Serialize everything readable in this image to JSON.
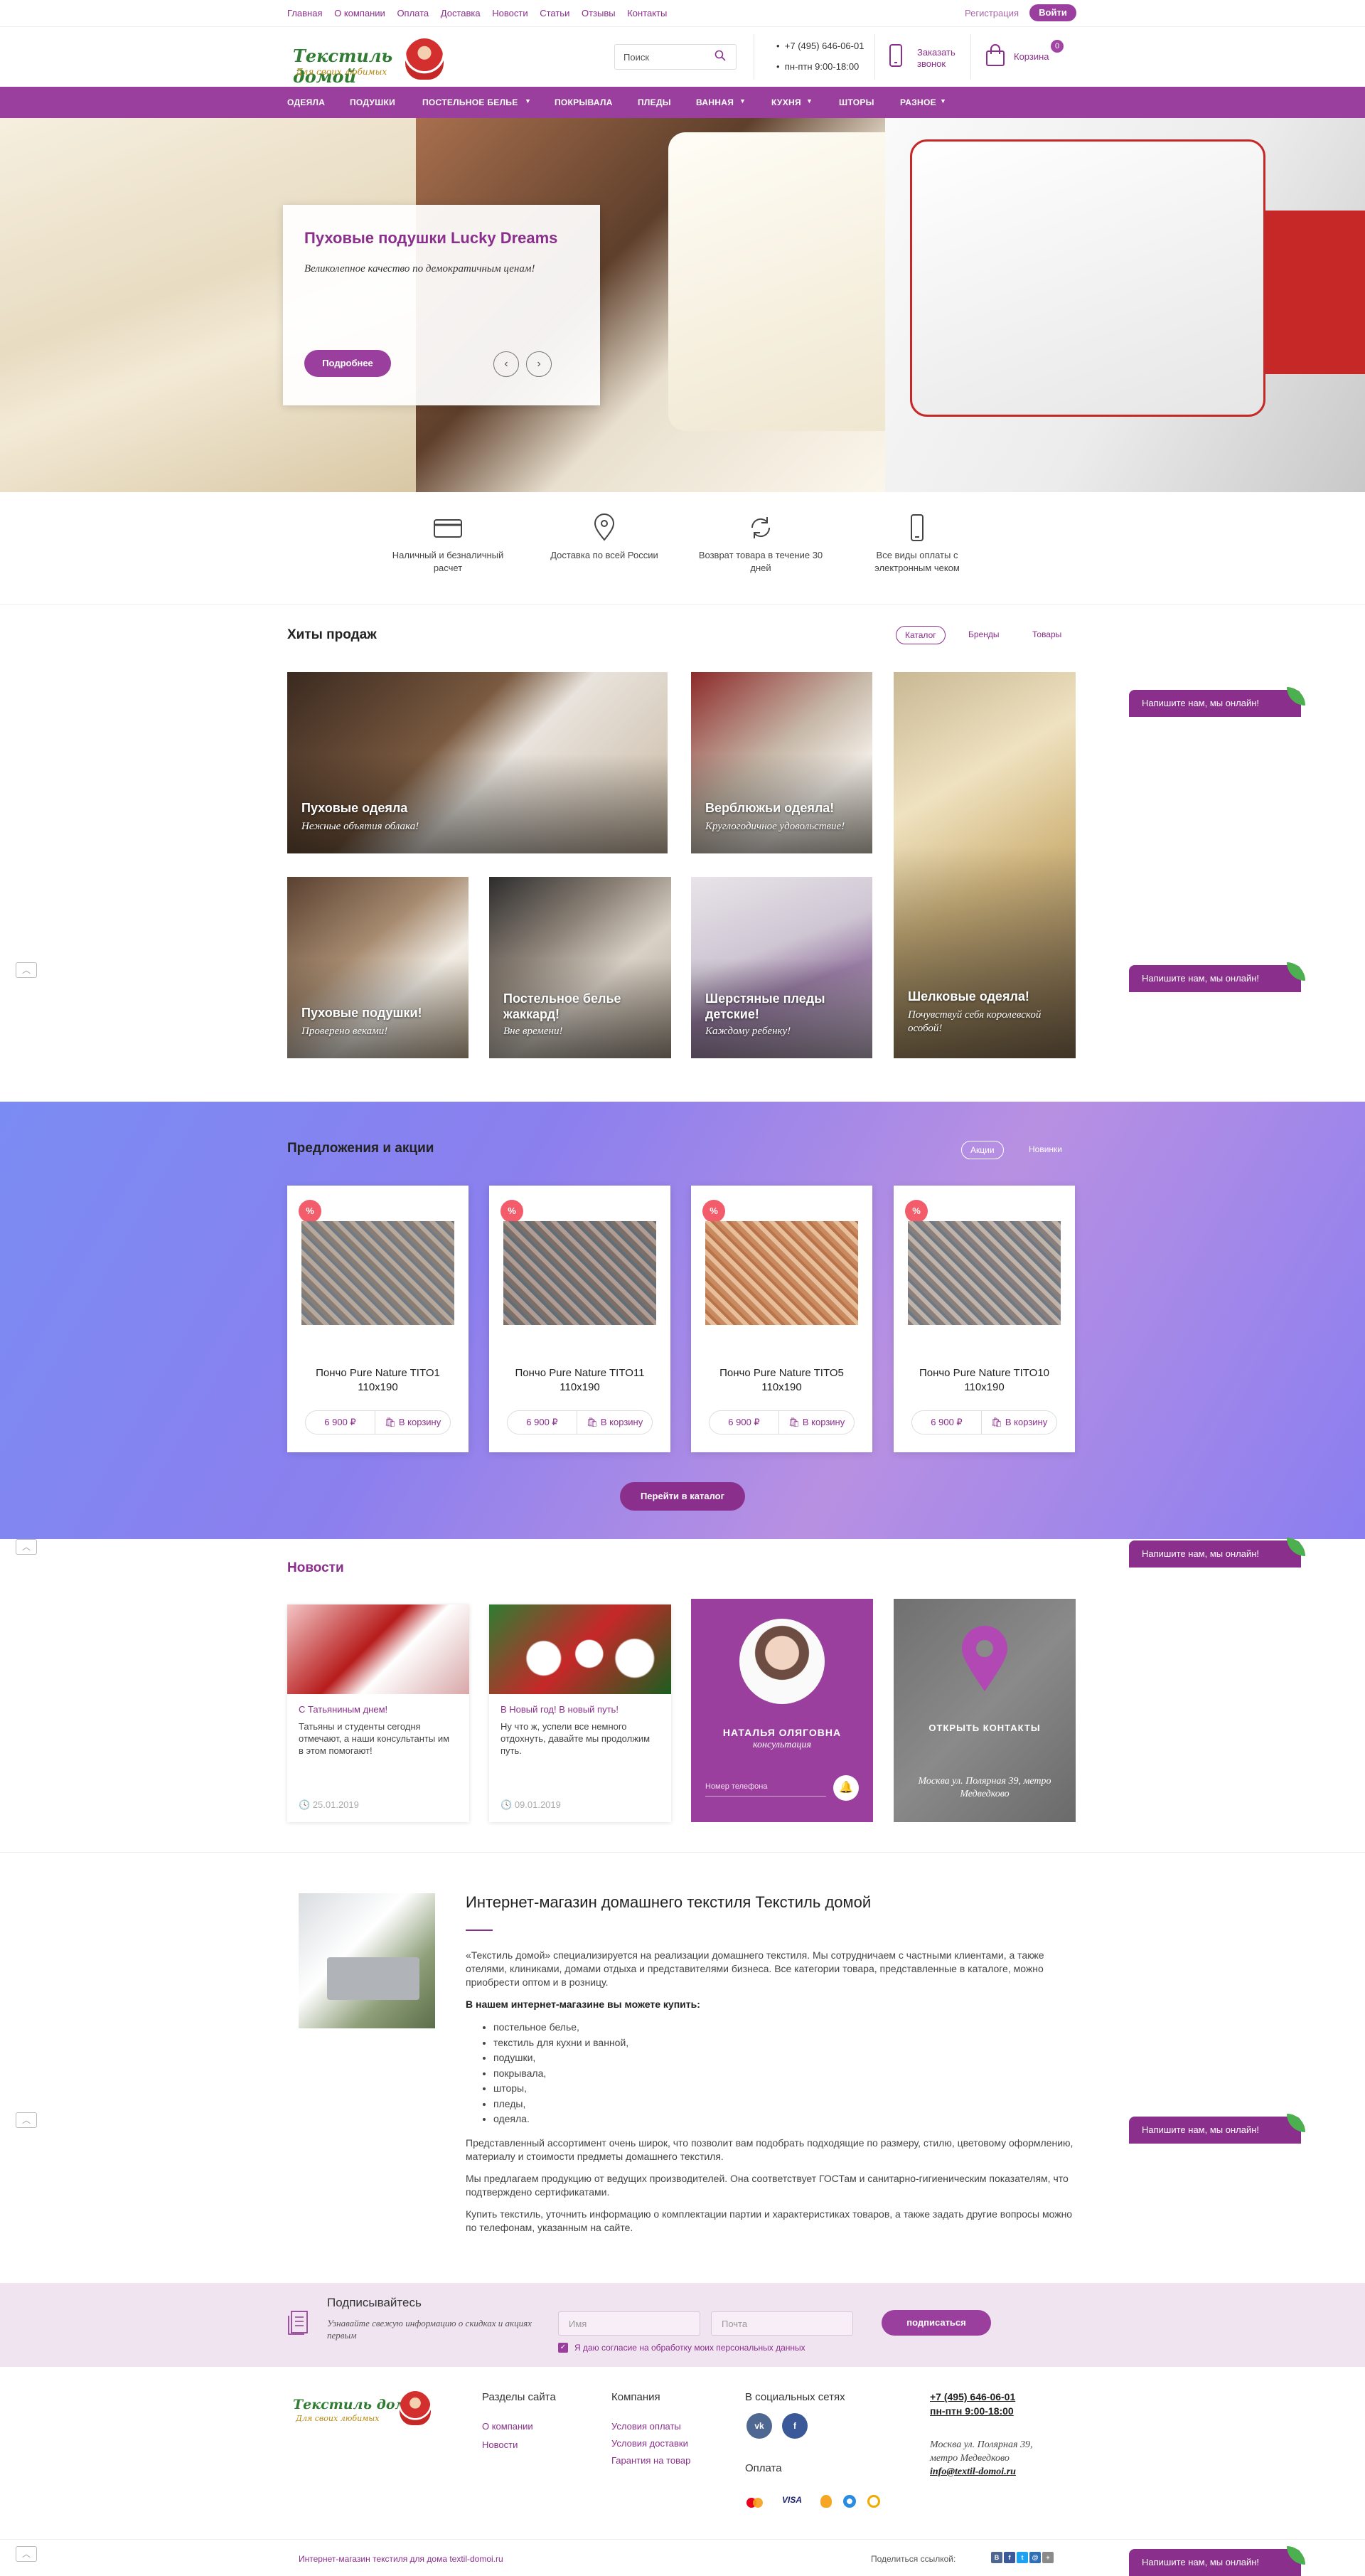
{
  "topnav": [
    "Главная",
    "О компании",
    "Оплата",
    "Доставка",
    "Новости",
    "Статьи",
    "Отзывы",
    "Контакты"
  ],
  "auth": {
    "register": "Регистрация",
    "login": "Войти"
  },
  "logo": {
    "name": "Текстиль домой",
    "tagline": "Для своих любимых"
  },
  "search": {
    "placeholder": "Поиск"
  },
  "contacts": {
    "phone": "+7 (495) 646-06-01",
    "hours": "пн-птн 9:00-18:00"
  },
  "callback": {
    "line1": "Заказать",
    "line2": "звонок"
  },
  "cart": {
    "label": "Корзина",
    "count": "0"
  },
  "mainnav": [
    "ОДЕЯЛА",
    "ПОДУШКИ",
    "ПОСТЕЛЬНОЕ БЕЛЬЕ",
    "ПОКРЫВАЛА",
    "ПЛЕДЫ",
    "ВАННАЯ",
    "КУХНЯ",
    "ШТОРЫ",
    "РАЗНОЕ"
  ],
  "hero": {
    "title": "Пуховые подушки Lucky Dreams",
    "subtitle": "Великолепное качество по демократичным ценам!",
    "button": "Подробнее",
    "prev": "‹",
    "next": "›"
  },
  "features": [
    {
      "icon": "card-icon",
      "text": "Наличный и безналичный расчет"
    },
    {
      "icon": "location-pin-icon",
      "text": "Доставка по всей России"
    },
    {
      "icon": "return-icon",
      "text": "Возврат товара в течение 30 дней"
    },
    {
      "icon": "phone-icon",
      "text": "Все виды оплаты с электронным чеком"
    }
  ],
  "hits": {
    "title": "Хиты продаж",
    "tabs": [
      "Каталог",
      "Бренды",
      "Товары"
    ],
    "tiles": [
      {
        "title": "Пуховые одеяла",
        "sub": "Нежные объятия облака!"
      },
      {
        "title": "Верблюжьи одеяла!",
        "sub": "Круглогодичное удовольствие!"
      },
      {
        "title": "Шелковые одеяла!",
        "sub": "Почувствуй себя королевской особой!"
      },
      {
        "title": "Пуховые подушки!",
        "sub": "Проверено веками!"
      },
      {
        "title": "Постельное белье жаккард!",
        "sub": "Вне времени!"
      },
      {
        "title": "Шерстяные пледы детские!",
        "sub": "Каждому ребенку!"
      }
    ]
  },
  "offers": {
    "title": "Предложения и акции",
    "tabs": [
      "Акции",
      "Новинки"
    ],
    "badge": "%",
    "products": [
      {
        "name": "Пончо Pure Nature TITO1 110х190",
        "price": "6 900 ₽",
        "cart": "В корзину"
      },
      {
        "name": "Пончо Pure Nature TITO11 110х190",
        "price": "6 900 ₽",
        "cart": "В корзину"
      },
      {
        "name": "Пончо Pure Nature TITO5 110х190",
        "price": "6 900 ₽",
        "cart": "В корзину"
      },
      {
        "name": "Пончо Pure Nature TITO10 110х190",
        "price": "6 900 ₽",
        "cart": "В корзину"
      }
    ],
    "catalog_button": "Перейти в каталог"
  },
  "news": {
    "title": "Новости",
    "items": [
      {
        "head": "С Татьяниным днем!",
        "text": "Татьяны и студенты сегодня отмечают, а наши консультанты им в этом помогают!",
        "date": "25.01.2019"
      },
      {
        "head": "В Новый год! В новый путь!",
        "text": "Ну что ж, успели все немного отдохнуть, давайте мы продолжим путь.",
        "date": "09.01.2019"
      }
    ],
    "consult": {
      "name": "НАТАЛЬЯ ОЛЯГОВНА",
      "role": "консультация",
      "placeholder": "Номер телефона"
    },
    "map": {
      "title": "ОТКРЫТЬ КОНТАКТЫ",
      "address": "Москва ул. Полярная 39, метро Медведково"
    }
  },
  "chat": "Напишите нам, мы онлайн!",
  "about": {
    "title": "Интернет-магазин домашнего текстиля Текстиль домой",
    "p1": "«Текстиль домой» специализируется на реализации домашнего текстиля. Мы сотрудничаем с частными клиентами, а также отелями, клиниками, домами отдыха и представителями бизнеса. Все категории товара, представленные в каталоге, можно приобрести оптом и в розницу.",
    "listhead": "В нашем интернет-магазине вы можете купить:",
    "list": [
      "постельное белье,",
      "текстиль для кухни и ванной,",
      "подушки,",
      "покрывала,",
      "шторы,",
      "пледы,",
      "одеяла."
    ],
    "p2": "Представленный ассортимент очень широк, что позволит вам подобрать подходящие по размеру, стилю, цветовому оформлению, материалу и стоимости предметы домашнего текстиля.",
    "p3": "Мы предлагаем продукцию от ведущих производителей. Она соответствует ГОСТам и санитарно-гигиеническим показателям, что подтверждено сертификатами.",
    "p4": "Купить текстиль, уточнить информацию о комплектации партии и характеристиках товаров, а также задать другие вопросы можно по телефонам, указанным на сайте."
  },
  "subscribe": {
    "title": "Подписывайтесь",
    "text": "Узнавайте свежую информацию о скидках и акциях первым",
    "name": "Имя",
    "email": "Почта",
    "button": "подписаться",
    "consent": "Я даю согласие на обработку моих персональных данных"
  },
  "footer": {
    "col1": {
      "title": "Разделы сайта",
      "links": [
        "О компании",
        "Новости"
      ]
    },
    "col2": {
      "title": "Компания",
      "links": [
        "Условия оплаты",
        "Условия доставки",
        "Гарантия на товар"
      ]
    },
    "social": {
      "title": "В социальных сетях",
      "vk": "vk",
      "fb": "f"
    },
    "payment": {
      "title": "Оплата",
      "items": [
        "mastercard",
        "VISA",
        "yandex",
        "webmoney",
        "qiwi"
      ]
    },
    "phone": "+7 (495) 646-06-01",
    "hours": "пн-птн 9:00-18:00",
    "address": "Москва ул. Полярная 39, метро Медведково",
    "email": "info@textil-domoi.ru",
    "copyright": "Интернет-магазин текстиля для дома textil-domoi.ru",
    "share": "Поделиться ссылкой:"
  },
  "colors": {
    "brand": "#9b3f9e",
    "accent": "#8a2f8c",
    "sale": "#f25c6b"
  }
}
